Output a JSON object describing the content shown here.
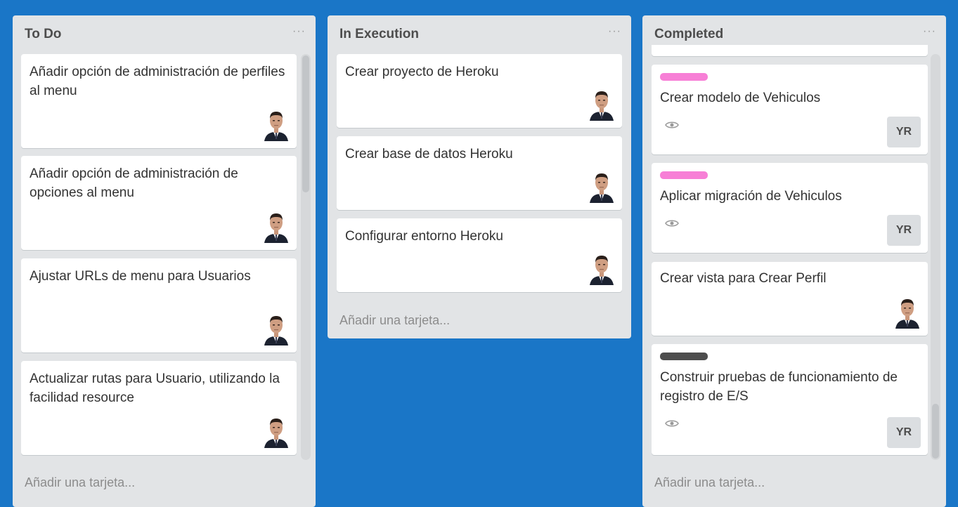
{
  "lists": [
    {
      "title": "To Do",
      "menu": "···",
      "cards": [
        {
          "title": "Añadir opción de administración de perfiles al menu",
          "member": "avatar"
        },
        {
          "title": "Añadir opción de administración de opciones al menu",
          "member": "avatar"
        },
        {
          "title": "Ajustar URLs de menu para Usuarios",
          "member": "avatar"
        },
        {
          "title": "Actualizar rutas para Usuario, utilizando la facilidad resource",
          "member": "avatar"
        }
      ],
      "add_card": "Añadir una tarjeta..."
    },
    {
      "title": "In Execution",
      "menu": "···",
      "cards": [
        {
          "title": "Crear proyecto de Heroku",
          "member": "avatar"
        },
        {
          "title": "Crear base de datos Heroku",
          "member": "avatar"
        },
        {
          "title": "Configurar entorno Heroku",
          "member": "avatar"
        }
      ],
      "add_card": "Añadir una tarjeta..."
    },
    {
      "title": "Completed",
      "menu": "···",
      "cards": [
        {
          "title": "Crear modelo de Vehiculos",
          "label_color": "#f77fd6",
          "badge": "eye-icon",
          "member_initials": "YR"
        },
        {
          "title": "Aplicar migración de Vehiculos",
          "label_color": "#f77fd6",
          "badge": "eye-icon",
          "member_initials": "YR"
        },
        {
          "title": "Crear vista para Crear Perfil",
          "member": "avatar"
        },
        {
          "title": "Construir pruebas de funcionamiento de registro de E/S",
          "label_color": "#4d4d4d",
          "badge": "eye-icon",
          "member_initials": "YR"
        }
      ],
      "add_card": "Añadir una tarjeta..."
    }
  ],
  "colors": {
    "board_background": "#1a76c7",
    "list_background": "#e2e4e6",
    "card_background": "#ffffff"
  }
}
